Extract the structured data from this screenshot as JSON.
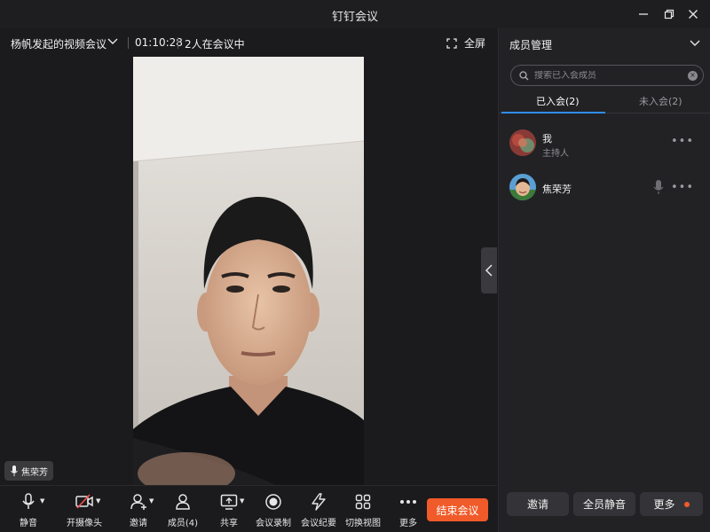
{
  "window": {
    "title": "钉钉会议"
  },
  "meeting": {
    "name": "杨帆发起的视频会议",
    "duration": "01:10:28",
    "participants_text": "2人在会议中",
    "fullscreen_label": "全屏",
    "active_speaker": "焦荣芳"
  },
  "toolbar": {
    "mute": "静音",
    "camera": "开摄像头",
    "invite": "邀请",
    "members": "成员(4)",
    "share": "共享",
    "record": "会议录制",
    "minutes": "会议纪要",
    "switch_view": "切换视图",
    "more": "更多",
    "end": "结束会议"
  },
  "panel": {
    "title": "成员管理",
    "search_placeholder": "搜索已入会成员",
    "tab_joined": "已入会(2)",
    "tab_not_joined": "未入会(2)",
    "members": [
      {
        "name": "我",
        "role": "主持人"
      },
      {
        "name": "焦荣芳",
        "role": ""
      }
    ],
    "btn_invite": "邀请",
    "btn_mute_all": "全员静音",
    "btn_more": "更多"
  },
  "colors": {
    "accent": "#2f8df5",
    "end_button": "#f15a29",
    "background": "#1b1b1e"
  }
}
